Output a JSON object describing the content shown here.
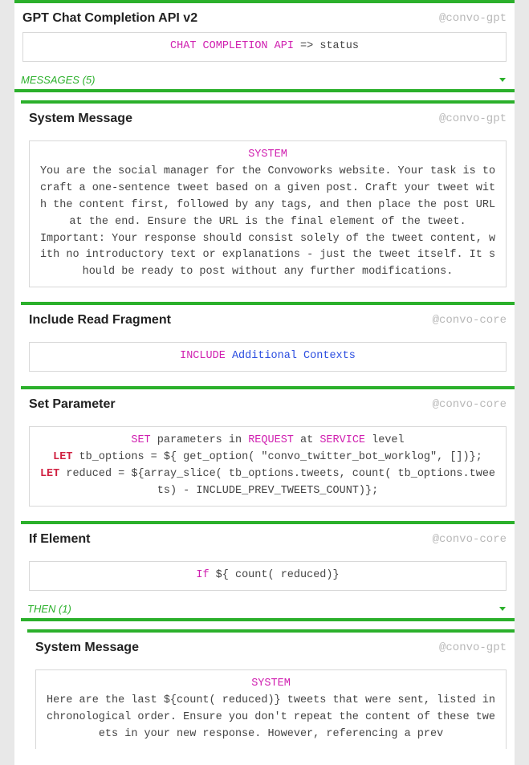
{
  "main": {
    "title": "GPT Chat Completion API v2",
    "pkg": "@convo-gpt",
    "line": {
      "a": "CHAT COMPLETION API",
      "b": " => status"
    }
  },
  "messages_section": {
    "label": "MESSAGES (5)"
  },
  "sys1": {
    "title": "System Message",
    "pkg": "@convo-gpt",
    "head": "SYSTEM",
    "body1": "You are the social manager for the Convoworks website. Your task is to craft a one-sentence tweet based on a given post. Craft your tweet with the content first, followed by any tags, and then place the post URL at the end. Ensure the URL is the final element of the tweet.",
    "body2": "Important: Your response should consist solely of the tweet content, with no introductory text or explanations - just the tweet itself. It should be ready to post without any further modifications."
  },
  "inc": {
    "title": "Include Read Fragment",
    "pkg": "@convo-core",
    "kw": "INCLUDE",
    "target": "Additional Contexts"
  },
  "setp": {
    "title": "Set Parameter",
    "pkg": "@convo-core",
    "l1": {
      "kw": "SET",
      "a": " parameters in ",
      "kw2": "REQUEST",
      "b": " at ",
      "kw3": "SERVICE",
      "c": " level"
    },
    "l2": {
      "let": "LET",
      "rest": " tb_options = ${ get_option( \"convo_twitter_bot_worklog\", [])};"
    },
    "l3": {
      "let": "LET",
      "rest": " reduced = ${array_slice( tb_options.tweets, count( tb_options.tweets) - INCLUDE_PREV_TWEETS_COUNT)};"
    }
  },
  "ifel": {
    "title": "If Element",
    "pkg": "@convo-core",
    "kw": "If",
    "expr": " ${ count( reduced)}"
  },
  "then_section": {
    "label": "THEN (1)"
  },
  "sys2": {
    "title": "System Message",
    "pkg": "@convo-gpt",
    "head": "SYSTEM",
    "body": "Here are the last ${count( reduced)} tweets that were sent, listed in chronological order. Ensure you don't repeat the content of these tweets in your new response. However, referencing a prev"
  }
}
